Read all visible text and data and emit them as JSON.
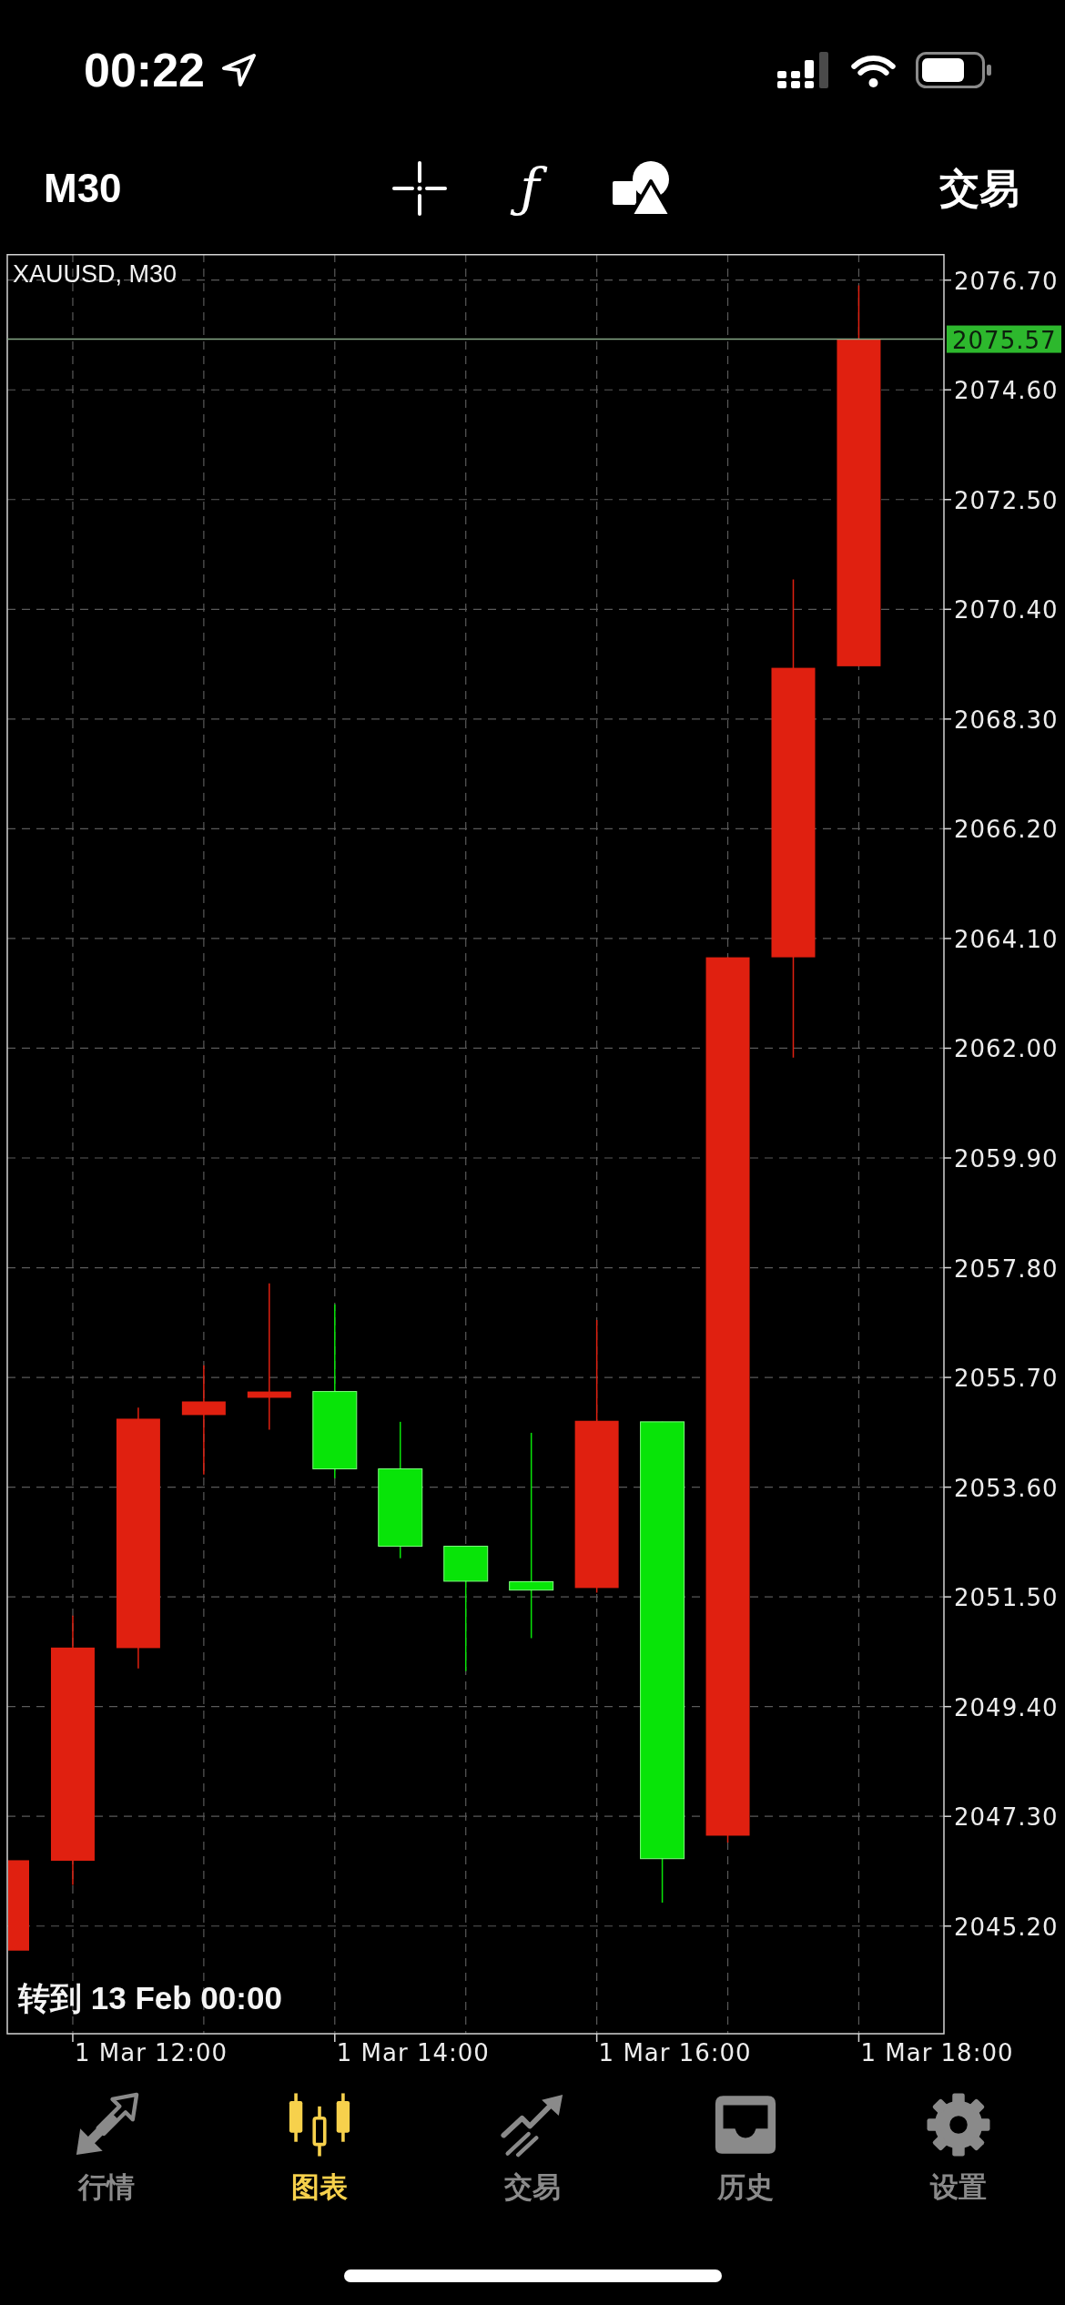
{
  "status_bar": {
    "time": "00:22"
  },
  "toolbar": {
    "timeframe": "M30",
    "indicator_symbol": "ƒ",
    "trade_button": "交易"
  },
  "chart": {
    "title": "XAUUSD, M30",
    "price_labels": [
      "2076.70",
      "2074.60",
      "2072.50",
      "2070.40",
      "2068.30",
      "2066.20",
      "2064.10",
      "2062.00",
      "2059.90",
      "2057.80",
      "2055.70",
      "2053.60",
      "2051.50",
      "2049.40",
      "2047.30",
      "2045.20"
    ],
    "current_price": "2075.57",
    "time_labels": [
      "1 Mar 12:00",
      "1 Mar 14:00",
      "1 Mar 16:00",
      "1 Mar 18:00"
    ],
    "goto_button": "转到 13 Feb 00:00"
  },
  "tabs": [
    {
      "label": "行情",
      "selected": false
    },
    {
      "label": "图表",
      "selected": true
    },
    {
      "label": "交易",
      "selected": false
    },
    {
      "label": "历史",
      "selected": false
    },
    {
      "label": "设置",
      "selected": false
    }
  ]
}
